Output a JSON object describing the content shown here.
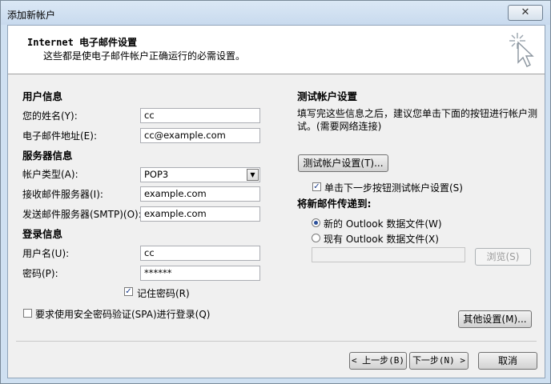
{
  "window": {
    "title": "添加新帐户",
    "close_glyph": "✕"
  },
  "header": {
    "title": "Internet 电子邮件设置",
    "subtitle": "这些都是使电子邮件帐户正确运行的必需设置。"
  },
  "user_info": {
    "section": "用户信息",
    "name_label": "您的姓名(Y):",
    "name_value": "cc",
    "email_label": "电子邮件地址(E):",
    "email_value": "cc@example.com"
  },
  "server_info": {
    "section": "服务器信息",
    "account_type_label": "帐户类型(A):",
    "account_type_value": "POP3",
    "incoming_label": "接收邮件服务器(I):",
    "incoming_value": "example.com",
    "outgoing_label": "发送邮件服务器(SMTP)(O):",
    "outgoing_value": "example.com"
  },
  "login_info": {
    "section": "登录信息",
    "username_label": "用户名(U):",
    "username_value": "cc",
    "password_label": "密码(P):",
    "password_value": "******",
    "remember_label": "记住密码(R)",
    "remember_checked": true,
    "spa_label": "要求使用安全密码验证(SPA)进行登录(Q)",
    "spa_checked": false
  },
  "test_settings": {
    "section": "测试帐户设置",
    "description": "填写完这些信息之后，建议您单击下面的按钮进行帐户测试。(需要网络连接)",
    "test_button": "测试帐户设置(T)...",
    "auto_test_label": "单击下一步按钮测试帐户设置(S)",
    "auto_test_checked": true
  },
  "deliver": {
    "section": "将新邮件传递到:",
    "new_file_label": "新的 Outlook 数据文件(W)",
    "existing_file_label": "现有 Outlook 数据文件(X)",
    "selected": "new",
    "path_value": "",
    "browse_button": "浏览(S)"
  },
  "more_settings_button": "其他设置(M)...",
  "footer": {
    "back_button": "< 上一步(B)",
    "next_button": "下一步(N) >",
    "cancel_button": "取消"
  },
  "icons": {
    "checkmark": "✓",
    "dropdown": "▼"
  }
}
